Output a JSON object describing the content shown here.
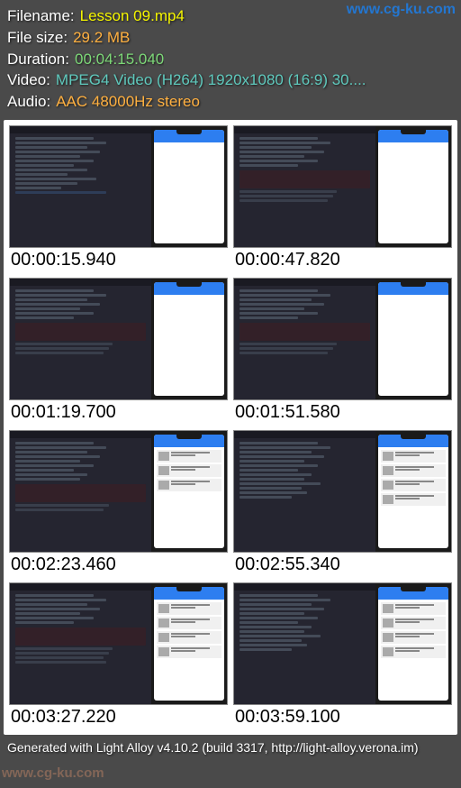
{
  "watermark": {
    "top": "www.cg-ku.com",
    "bottom": "www.cg-ku.com"
  },
  "header": {
    "filename_label": "Filename:",
    "filename_value": "Lesson 09.mp4",
    "filesize_label": "File size:",
    "filesize_value": "29.2 MB",
    "duration_label": "Duration:",
    "duration_value": "00:04:15.040",
    "video_label": "Video:",
    "video_value": "MPEG4 Video (H264) 1920x1080 (16:9) 30....",
    "audio_label": "Audio:",
    "audio_value": "AAC 48000Hz stereo"
  },
  "thumbnails": [
    {
      "timestamp": "00:00:15.940"
    },
    {
      "timestamp": "00:00:47.820"
    },
    {
      "timestamp": "00:01:19.700"
    },
    {
      "timestamp": "00:01:51.580"
    },
    {
      "timestamp": "00:02:23.460"
    },
    {
      "timestamp": "00:02:55.340"
    },
    {
      "timestamp": "00:03:27.220"
    },
    {
      "timestamp": "00:03:59.100"
    }
  ],
  "footer": {
    "text": "Generated with Light Alloy v4.10.2 (build 3317, http://light-alloy.verona.im)"
  }
}
